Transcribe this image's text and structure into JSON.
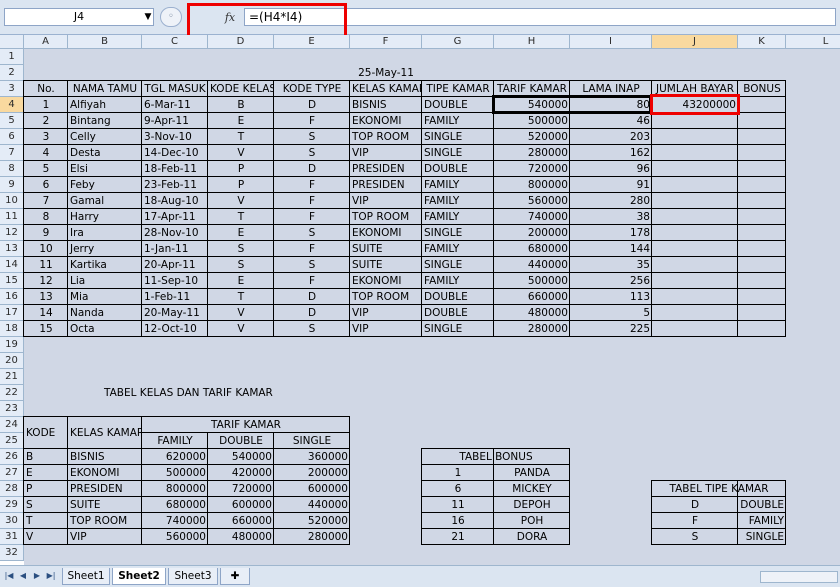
{
  "formula_bar": {
    "name_box": "J4",
    "name_dropdown": "▼",
    "fx_label": "fx",
    "formula": "=(H4*I4)"
  },
  "columns": [
    "A",
    "B",
    "C",
    "D",
    "E",
    "F",
    "G",
    "H",
    "I",
    "J",
    "K",
    "L"
  ],
  "selected_column": "J",
  "rows": [
    "1",
    "2",
    "3",
    "4",
    "5",
    "6",
    "7",
    "8",
    "9",
    "10",
    "11",
    "12",
    "13",
    "14",
    "15",
    "16",
    "17",
    "18",
    "19",
    "20",
    "21",
    "22",
    "23",
    "24",
    "25",
    "26",
    "27",
    "28",
    "29",
    "30",
    "31",
    "32"
  ],
  "selected_row": "4",
  "sheet": {
    "date": "25-May-11",
    "main_headers": [
      "No.",
      "NAMA TAMU",
      "TGL MASUK",
      "KODE KELAS",
      "KODE TYPE",
      "KELAS KAMAR",
      "TIPE KAMAR",
      "TARIF KAMAR",
      "LAMA INAP",
      "JUMLAH BAYAR",
      "BONUS"
    ],
    "main_rows": [
      [
        "1",
        "Alfiyah",
        "6-Mar-11",
        "B",
        "D",
        "BISNIS",
        "DOUBLE",
        "540000",
        "80",
        "43200000",
        ""
      ],
      [
        "2",
        "Bintang",
        "9-Apr-11",
        "E",
        "F",
        "EKONOMI",
        "FAMILY",
        "500000",
        "46",
        "",
        ""
      ],
      [
        "3",
        "Celly",
        "3-Nov-10",
        "T",
        "S",
        "TOP ROOM",
        "SINGLE",
        "520000",
        "203",
        "",
        ""
      ],
      [
        "4",
        "Desta",
        "14-Dec-10",
        "V",
        "S",
        "VIP",
        "SINGLE",
        "280000",
        "162",
        "",
        ""
      ],
      [
        "5",
        "Elsi",
        "18-Feb-11",
        "P",
        "D",
        "PRESIDEN",
        "DOUBLE",
        "720000",
        "96",
        "",
        ""
      ],
      [
        "6",
        "Feby",
        "23-Feb-11",
        "P",
        "F",
        "PRESIDEN",
        "FAMILY",
        "800000",
        "91",
        "",
        ""
      ],
      [
        "7",
        "Gamal",
        "18-Aug-10",
        "V",
        "F",
        "VIP",
        "FAMILY",
        "560000",
        "280",
        "",
        ""
      ],
      [
        "8",
        "Harry",
        "17-Apr-11",
        "T",
        "F",
        "TOP ROOM",
        "FAMILY",
        "740000",
        "38",
        "",
        ""
      ],
      [
        "9",
        "Ira",
        "28-Nov-10",
        "E",
        "S",
        "EKONOMI",
        "SINGLE",
        "200000",
        "178",
        "",
        ""
      ],
      [
        "10",
        "Jerry",
        "1-Jan-11",
        "S",
        "F",
        "SUITE",
        "FAMILY",
        "680000",
        "144",
        "",
        ""
      ],
      [
        "11",
        "Kartika",
        "20-Apr-11",
        "S",
        "S",
        "SUITE",
        "SINGLE",
        "440000",
        "35",
        "",
        ""
      ],
      [
        "12",
        "Lia",
        "11-Sep-10",
        "E",
        "F",
        "EKONOMI",
        "FAMILY",
        "500000",
        "256",
        "",
        ""
      ],
      [
        "13",
        "Mia",
        "1-Feb-11",
        "T",
        "D",
        "TOP ROOM",
        "DOUBLE",
        "660000",
        "113",
        "",
        ""
      ],
      [
        "14",
        "Nanda",
        "20-May-11",
        "V",
        "D",
        "VIP",
        "DOUBLE",
        "480000",
        "5",
        "",
        ""
      ],
      [
        "15",
        "Octa",
        "12-Oct-10",
        "V",
        "S",
        "VIP",
        "SINGLE",
        "280000",
        "225",
        "",
        ""
      ]
    ],
    "kelas_title": "TABEL KELAS DAN TARIF KAMAR",
    "kelas_headers": {
      "kode": "KODE",
      "kelas": "KELAS KAMAR",
      "tarif": "TARIF KAMAR",
      "family": "FAMILY",
      "double": "DOUBLE",
      "single": "SINGLE"
    },
    "kelas_rows": [
      [
        "B",
        "BISNIS",
        "620000",
        "540000",
        "360000"
      ],
      [
        "E",
        "EKONOMI",
        "500000",
        "420000",
        "200000"
      ],
      [
        "P",
        "PRESIDEN",
        "800000",
        "720000",
        "600000"
      ],
      [
        "S",
        "SUITE",
        "680000",
        "600000",
        "440000"
      ],
      [
        "T",
        "TOP ROOM",
        "740000",
        "660000",
        "520000"
      ],
      [
        "V",
        "VIP",
        "560000",
        "480000",
        "280000"
      ]
    ],
    "bonus_title": "TABEL BONUS",
    "bonus_rows": [
      [
        "1",
        "PANDA"
      ],
      [
        "6",
        "MICKEY"
      ],
      [
        "11",
        "DEPOH"
      ],
      [
        "16",
        "POH"
      ],
      [
        "21",
        "DORA"
      ]
    ],
    "tipe_title": "TABEL TIPE KAMAR",
    "tipe_rows": [
      [
        "D",
        "DOUBLE"
      ],
      [
        "F",
        "FAMILY"
      ],
      [
        "S",
        "SINGLE"
      ]
    ]
  },
  "sheet_tabs": [
    "Sheet1",
    "Sheet2",
    "Sheet3"
  ],
  "active_tab": "Sheet2",
  "nav_icons": [
    "first-sheet-icon",
    "prev-sheet-icon",
    "next-sheet-icon",
    "last-sheet-icon"
  ],
  "colors": {
    "highlight_red": "#e00000",
    "selected_header": "#f9d99f",
    "header_bg": "#e4ecf7"
  }
}
